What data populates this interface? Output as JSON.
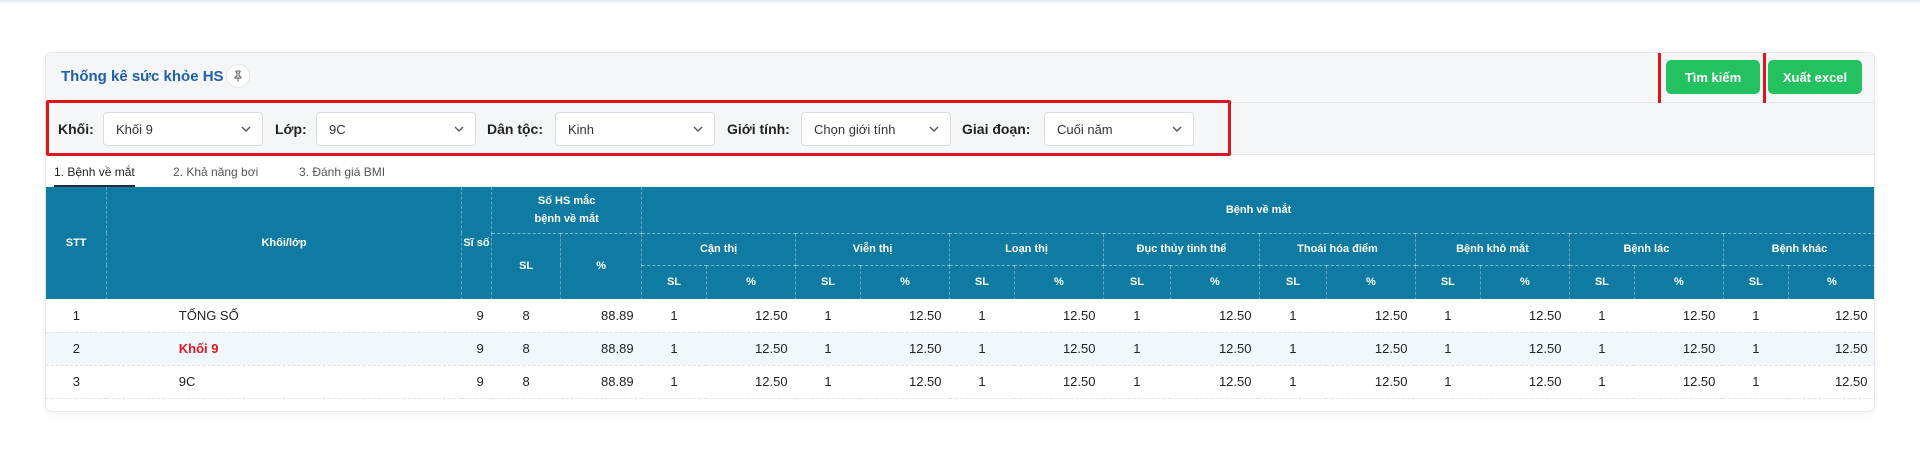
{
  "header": {
    "title": "Thống kê sức khỏe HS",
    "search_label": "Tìm kiếm",
    "export_label": "Xuất excel"
  },
  "filters": {
    "khoi": {
      "label": "Khối:",
      "value": "Khối 9"
    },
    "lop": {
      "label": "Lớp:",
      "value": "9C"
    },
    "dantoc": {
      "label": "Dân tộc:",
      "value": "Kinh"
    },
    "gioitinh": {
      "label": "Giới tính:",
      "value": "Chọn giới tính"
    },
    "giaidoan": {
      "label": "Giai đoạn:",
      "value": "Cuối năm"
    }
  },
  "tabs": [
    {
      "label": "1. Bệnh về mắt"
    },
    {
      "label": "2. Khả năng bơi"
    },
    {
      "label": "3. Đánh giá BMI"
    }
  ],
  "table": {
    "h_stt": "STT",
    "h_khoi": "Khối/lớp",
    "h_siso": "Sĩ số",
    "h_somac_1": "Số HS mắc",
    "h_somac_2": "bệnh về mắt",
    "h_benh": "Bệnh về mắt",
    "h_sl": "SL",
    "h_pct": "%",
    "diseases": [
      "Cận thị",
      "Viễn thị",
      "Loạn thị",
      "Đục thủy tinh thể",
      "Thoái hóa điểm",
      "Bệnh khô mắt",
      "Bệnh lác",
      "Bệnh khác"
    ],
    "rows": [
      {
        "stt": "1",
        "name": "TỔNG SỐ",
        "siso": "9",
        "sl": "8",
        "pct": "88.89",
        "d": [
          "1",
          "12.50",
          "1",
          "12.50",
          "1",
          "12.50",
          "1",
          "12.50",
          "1",
          "12.50",
          "1",
          "12.50",
          "1",
          "12.50",
          "1",
          "12.50"
        ]
      },
      {
        "stt": "2",
        "name": "Khối 9",
        "siso": "9",
        "sl": "8",
        "pct": "88.89",
        "d": [
          "1",
          "12.50",
          "1",
          "12.50",
          "1",
          "12.50",
          "1",
          "12.50",
          "1",
          "12.50",
          "1",
          "12.50",
          "1",
          "12.50",
          "1",
          "12.50"
        ]
      },
      {
        "stt": "3",
        "name": "9C",
        "siso": "9",
        "sl": "8",
        "pct": "88.89",
        "d": [
          "1",
          "12.50",
          "1",
          "12.50",
          "1",
          "12.50",
          "1",
          "12.50",
          "1",
          "12.50",
          "1",
          "12.50",
          "1",
          "12.50",
          "1",
          "12.50"
        ]
      }
    ]
  },
  "colors": {
    "accent": "#0f7ba3",
    "button": "#23c160",
    "highlight": "#e0141c",
    "title": "#1f5fae"
  }
}
